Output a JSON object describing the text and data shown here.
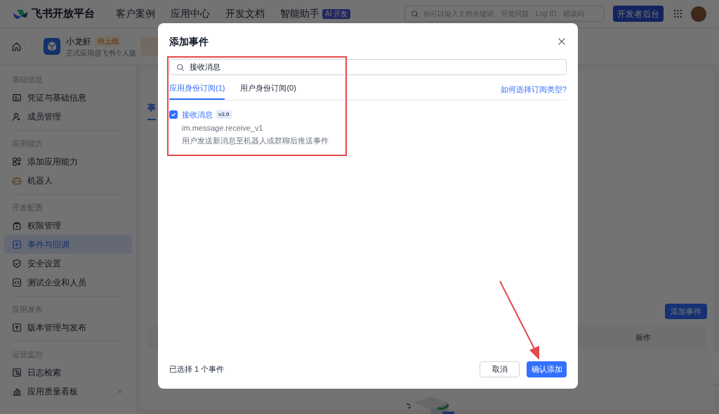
{
  "nav": {
    "logo_text": "飞书开放平台",
    "links": [
      "客户案例",
      "应用中心",
      "开发文档",
      "智能助手"
    ],
    "ai_badge": "AI 开发",
    "search_placeholder": "你可以输入文档关键词、开发问题、Log ID、错误码",
    "console_button": "开发者后台"
  },
  "app_header": {
    "name": "小龙虾",
    "status": "待上线",
    "subtitle": "正式应用@飞书个人版"
  },
  "sidebar": {
    "sections": [
      {
        "title": "基础信息",
        "items": [
          {
            "label": "凭证与基础信息",
            "kind": "link",
            "selected": false
          },
          {
            "label": "成员管理",
            "kind": "link",
            "selected": false
          }
        ]
      },
      {
        "title": "应用能力",
        "items": [
          {
            "label": "添加应用能力",
            "kind": "link",
            "selected": false
          },
          {
            "label": "机器人",
            "kind": "link",
            "selected": false
          }
        ]
      },
      {
        "title": "开发配置",
        "items": [
          {
            "label": "权限管理",
            "kind": "link",
            "selected": false
          },
          {
            "label": "事件与回调",
            "kind": "link",
            "selected": true
          },
          {
            "label": "安全设置",
            "kind": "link",
            "selected": false
          },
          {
            "label": "测试企业和人员",
            "kind": "link",
            "selected": false
          }
        ]
      },
      {
        "title": "应用发布",
        "items": [
          {
            "label": "版本管理与发布",
            "kind": "link",
            "selected": false
          }
        ]
      },
      {
        "title": "运营监控",
        "items": [
          {
            "label": "日志检索",
            "kind": "link",
            "selected": false
          },
          {
            "label": "应用质量看板",
            "kind": "group",
            "selected": false
          }
        ]
      }
    ]
  },
  "main": {
    "tab": "事",
    "add_button": "添加事件",
    "table_column": "操作"
  },
  "modal": {
    "title": "添加事件",
    "search_value": "接收消息",
    "tabs": [
      {
        "label": "应用身份订阅(1)",
        "selected": true
      },
      {
        "label": "用户身份订阅(0)",
        "selected": false
      }
    ],
    "help_link": "如何选择订阅类型?",
    "events": [
      {
        "name": "接收消息",
        "version": "v2.0",
        "code": "im.message.receive_v1",
        "description": "用户发送新消息至机器人或群聊后推送事件",
        "checked": true
      }
    ],
    "selected_text": "已选择 1 个事件",
    "cancel_button": "取消",
    "confirm_button": "确认添加"
  }
}
